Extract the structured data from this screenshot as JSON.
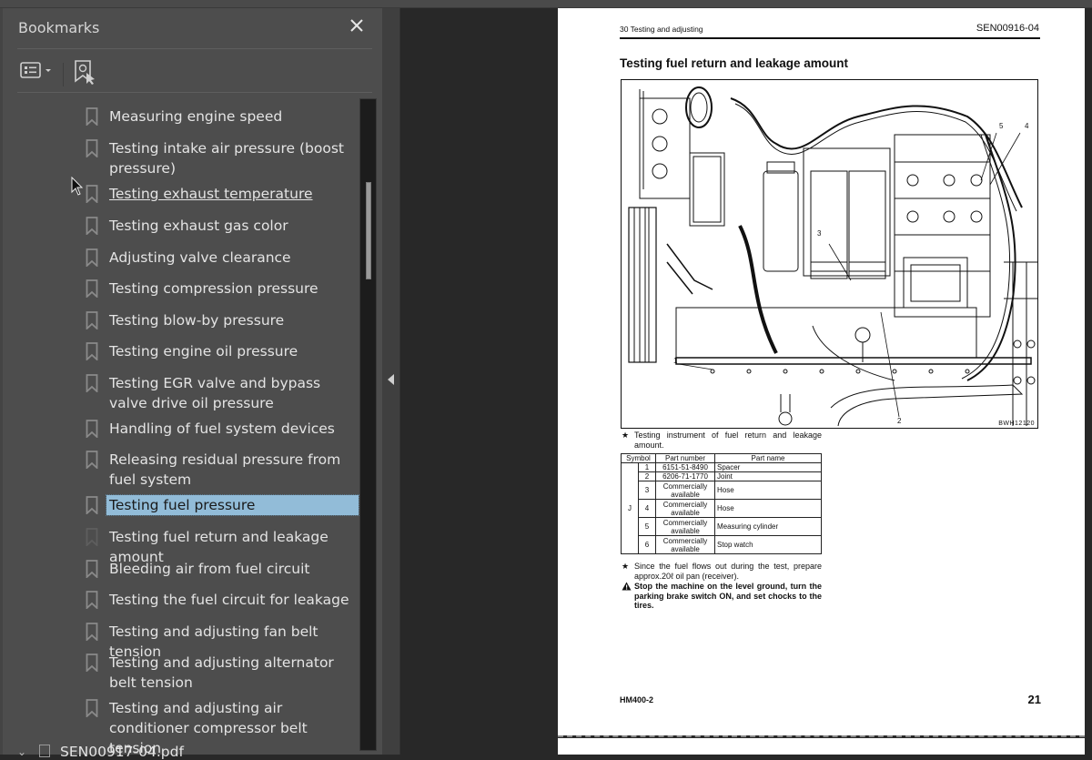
{
  "window": {
    "panel_title": "Bookmarks",
    "close_icon": "close-icon",
    "toolbar": [
      {
        "icon": "options-list-icon",
        "has_dropdown": true
      },
      {
        "icon": "find-current-bookmark-icon"
      }
    ]
  },
  "bookmarks": {
    "items": [
      {
        "label": "Measuring engine speed",
        "state": "normal"
      },
      {
        "label": "Testing intake air pressure (boost pressure)",
        "state": "normal"
      },
      {
        "label": "Testing exhaust temperature",
        "state": "hover"
      },
      {
        "label": "Testing exhaust gas color",
        "state": "normal"
      },
      {
        "label": "Adjusting valve clearance",
        "state": "normal"
      },
      {
        "label": "Testing compression pressure",
        "state": "normal"
      },
      {
        "label": "Testing blow-by pressure",
        "state": "normal"
      },
      {
        "label": "Testing engine oil pressure",
        "state": "normal"
      },
      {
        "label": "Testing EGR valve and bypass valve drive oil pressure",
        "state": "normal"
      },
      {
        "label": "Handling of fuel system devices",
        "state": "normal"
      },
      {
        "label": "Releasing residual pressure from fuel system",
        "state": "normal"
      },
      {
        "label": "Testing fuel pressure",
        "state": "selected"
      },
      {
        "label": "Testing fuel return and leakage amount",
        "state": "current-page"
      },
      {
        "label": "Bleeding air from fuel circuit",
        "state": "normal"
      },
      {
        "label": "Testing the fuel circuit for leakage",
        "state": "normal"
      },
      {
        "label": "Testing and adjusting fan belt tension",
        "state": "normal"
      },
      {
        "label": "Testing and adjusting alternator belt tension",
        "state": "normal"
      },
      {
        "label": "Testing and adjusting air conditioner compressor belt tension",
        "state": "normal"
      }
    ],
    "next_document": "SEN00917-04.pdf",
    "scroll_position_fraction": 0.13
  },
  "page": {
    "header_left": "30 Testing and adjusting",
    "header_right": "SEN00916-04",
    "title": "Testing fuel return and leakage amount",
    "figure_code": "BWH12120",
    "callouts": [
      "1",
      "2",
      "3",
      "4",
      "5"
    ],
    "note_instrument": "Testing instrument of fuel return and leakage amount.",
    "table": {
      "headers": [
        "Symbol",
        "Part number",
        "Part name"
      ],
      "symbol": "J",
      "rows": [
        {
          "no": "1",
          "part_number": "6151-51-8490",
          "part_name": "Spacer"
        },
        {
          "no": "2",
          "part_number": "6206-71-1770",
          "part_name": "Joint"
        },
        {
          "no": "3",
          "part_number": "Commercially available",
          "part_name": "Hose"
        },
        {
          "no": "4",
          "part_number": "Commercially available",
          "part_name": "Hose"
        },
        {
          "no": "5",
          "part_number": "Commercially available",
          "part_name": "Measuring cylinder"
        },
        {
          "no": "6",
          "part_number": "Commercially available",
          "part_name": "Stop watch"
        }
      ]
    },
    "note_fuel": "Since the fuel flows out during the test, prepare approx.20ℓ oil pan (receiver).",
    "warning": "Stop the machine on the level ground, turn the parking brake switch ON, and set chocks to the tires.",
    "star_glyph": "★",
    "warning_glyph": "▲",
    "footer_left": "HM400-2",
    "page_number": "21"
  }
}
